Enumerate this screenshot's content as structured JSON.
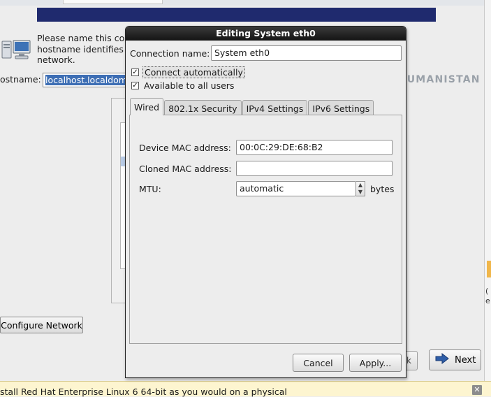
{
  "background": {
    "intro_lines": [
      "Please name this computer. The",
      "hostname identifies the computer on a",
      "network."
    ],
    "hostname_label": "ostname:",
    "hostname_value": "localhost.localdomain",
    "configure_network_label": "Configure Network",
    "back_partial": "k",
    "next_label": "Next",
    "bottom_message": "stall Red Hat Enterprise Linux 6 64-bit as you would on a physical",
    "right_edge_glyphs": "(\ne"
  },
  "watermark": {
    "text": "DOKUMANISTAN",
    "logo": "dokumanistan-logo"
  },
  "dialog": {
    "title": "Editing System eth0",
    "connection_name_label": "Connection name:",
    "connection_name_value": "System eth0",
    "connect_automatically": {
      "label": "Connect automatically",
      "checked": true
    },
    "available_to_all_users": {
      "label": "Available to all users",
      "checked": true
    },
    "tabs": [
      {
        "label": "Wired",
        "active": true
      },
      {
        "label": "802.1x Security",
        "active": false
      },
      {
        "label": "IPv4 Settings",
        "active": false
      },
      {
        "label": "IPv6 Settings",
        "active": false
      }
    ],
    "wired": {
      "device_mac_label": "Device MAC address:",
      "device_mac_value": "00:0C:29:DE:68:B2",
      "cloned_mac_label": "Cloned MAC address:",
      "cloned_mac_value": "",
      "mtu_label": "MTU:",
      "mtu_value": "automatic",
      "mtu_unit": "bytes"
    },
    "cancel_label": "Cancel",
    "apply_label": "Apply..."
  },
  "icons": {
    "next": "arrow-right-icon",
    "computer": "network-computer-icon",
    "close": "close-icon"
  },
  "colors": {
    "title_bar": "#1f2a6e",
    "selection": "#3d6eb4",
    "dialog_title": "#1c1c1c",
    "banner": "#fdf5d0"
  }
}
